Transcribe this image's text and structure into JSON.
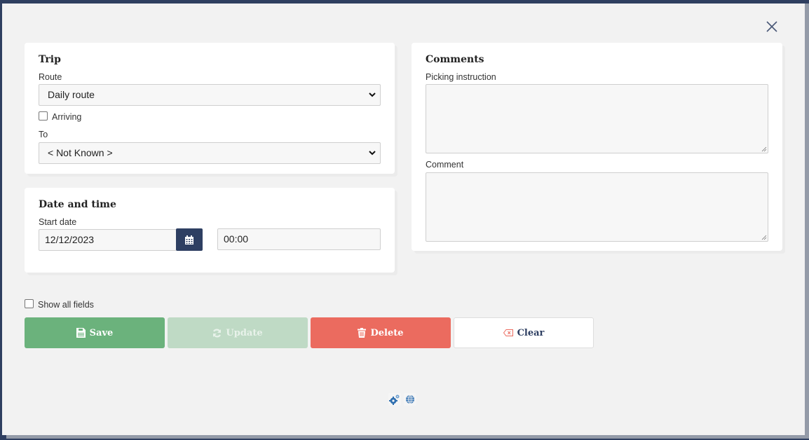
{
  "dialog": {
    "close_icon": "close-icon"
  },
  "trip": {
    "title": "Trip",
    "route_label": "Route",
    "route_value": "Daily route",
    "arriving_label": "Arriving",
    "arriving_checked": false,
    "to_label": "To",
    "to_value": "< Not Known >"
  },
  "datetime": {
    "title": "Date and time",
    "start_date_label": "Start date",
    "start_date_value": "12/12/2023",
    "time_value": "00:00",
    "calendar_icon": "calendar-icon"
  },
  "comments": {
    "title": "Comments",
    "picking_label": "Picking instruction",
    "picking_value": "",
    "comment_label": "Comment",
    "comment_value": ""
  },
  "options": {
    "show_all_label": "Show all fields",
    "show_all_checked": false
  },
  "actions": {
    "save": "Save",
    "update": "Update",
    "delete": "Delete",
    "clear": "Clear"
  },
  "footer": {
    "icons": [
      "settings-gears-icon",
      "globe-icon"
    ]
  },
  "colors": {
    "primary": "#2e3f62",
    "save": "#6bb27c",
    "update_disabled": "#bfdac5",
    "delete": "#eb6b5f",
    "background": "#f2f2f2"
  }
}
